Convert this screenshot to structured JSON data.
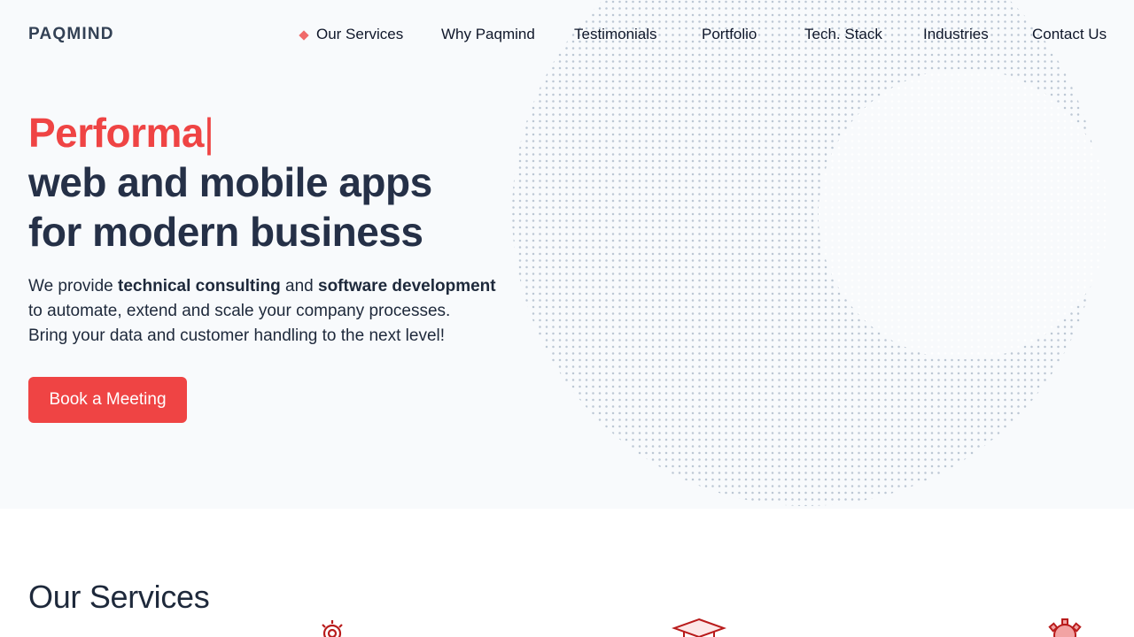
{
  "brand": {
    "logo_text": "PAQMIND",
    "accent_color": "#ef4444",
    "text_color": "#253047"
  },
  "nav": {
    "active_indicator_icon": "diamond-icon",
    "items": [
      {
        "label": "Our Services",
        "active": true
      },
      {
        "label": "Why Paqmind"
      },
      {
        "label": "Testimonials"
      },
      {
        "label": "Portfolio"
      },
      {
        "label": "Tech. Stack"
      },
      {
        "label": "Industries"
      },
      {
        "label": "Contact Us"
      }
    ]
  },
  "hero": {
    "typed_word": "Performa",
    "cursor": "|",
    "headline_line2": "web and mobile apps",
    "headline_line3": "for modern business",
    "lead": {
      "pre": "We provide ",
      "bold1": "technical consulting",
      "mid": " and ",
      "bold2": "software development",
      "line2": "to automate, extend and scale your company processes.",
      "line3": "Bring your data and customer handling to the next level!"
    },
    "cta_label": "Book a Meeting",
    "decoration_icon": "dotted-circle-pattern"
  },
  "services": {
    "title": "Our Services",
    "icons": [
      "gear-icon",
      "graduation-cap-icon",
      "gear-speed-icon"
    ]
  }
}
